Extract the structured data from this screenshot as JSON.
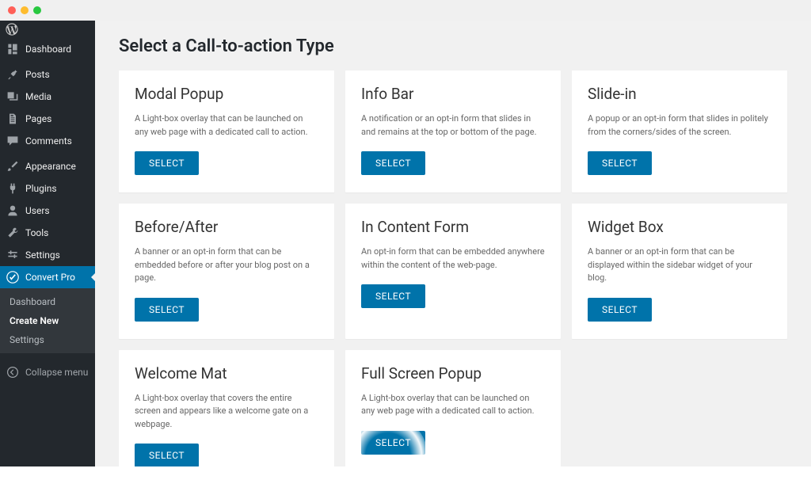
{
  "sidebar": {
    "items": [
      {
        "label": "Dashboard",
        "icon": "dashboard"
      },
      {
        "label": "Posts",
        "icon": "pin"
      },
      {
        "label": "Media",
        "icon": "media"
      },
      {
        "label": "Pages",
        "icon": "pages"
      },
      {
        "label": "Comments",
        "icon": "comment"
      },
      {
        "label": "Appearance",
        "icon": "brush"
      },
      {
        "label": "Plugins",
        "icon": "plug"
      },
      {
        "label": "Users",
        "icon": "user"
      },
      {
        "label": "Tools",
        "icon": "wrench"
      },
      {
        "label": "Settings",
        "icon": "sliders"
      },
      {
        "label": "Convert Pro",
        "icon": "convertpro",
        "active": true
      }
    ],
    "submenu": [
      {
        "label": "Dashboard"
      },
      {
        "label": "Create New",
        "current": true
      },
      {
        "label": "Settings"
      }
    ],
    "collapse_label": "Collapse menu"
  },
  "page": {
    "title": "Select a Call-to-action Type",
    "select_label": "SELECT"
  },
  "cards": [
    {
      "title": "Modal Popup",
      "desc": "A Light-box overlay that can be launched on any web page with a dedicated call to action."
    },
    {
      "title": "Info Bar",
      "desc": "A notification or an opt-in form that slides in and remains at the top or bottom of the page."
    },
    {
      "title": "Slide-in",
      "desc": "A popup or an opt-in form that slides in politely from the corners/sides of the screen."
    },
    {
      "title": "Before/After",
      "desc": "A banner or an opt-in form that can be embedded before or after your blog post on a page."
    },
    {
      "title": "In Content Form",
      "desc": "An opt-in form that can be embedded anywhere within the content of the web-page."
    },
    {
      "title": "Widget Box",
      "desc": "A banner or an opt-in form that can be displayed within the sidebar widget of your blog."
    },
    {
      "title": "Welcome Mat",
      "desc": "A Light-box overlay that covers the entire screen and appears like a welcome gate on a webpage."
    },
    {
      "title": "Full Screen Popup",
      "desc": "A Light-box overlay that can be launched on any web page with a dedicated call to action."
    }
  ]
}
